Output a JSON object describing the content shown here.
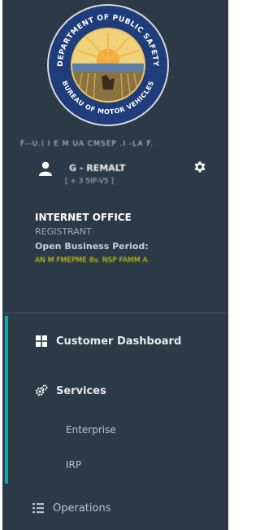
{
  "seal": {
    "top_text": "DEPARTMENT OF PUBLIC SAFETY",
    "bottom_text": "BUREAU OF MOTOR VEHICLES"
  },
  "location_line": "F--U.I I E M UA CMSEP .I -LA F.",
  "user": {
    "name": "G - REMALT",
    "sub": "[ + 3 5IP-V5 ]",
    "icon": "user-icon",
    "settings_icon": "gear-icon"
  },
  "office": {
    "title": "INTERNET OFFICE",
    "role": "REGISTRANT",
    "period_label": "Open Business Period:",
    "period_value": "AN M FMEPME 8v. NSP FAMM A"
  },
  "nav": {
    "customer_dashboard": "Customer Dashboard",
    "services": "Services",
    "enterprise": "Enterprise",
    "irp": "IRP",
    "operations": "Operations"
  },
  "colors": {
    "sidebar_bg": "#2c3a48",
    "accent": "#1aa3a8",
    "period_value": "#e6e000"
  }
}
